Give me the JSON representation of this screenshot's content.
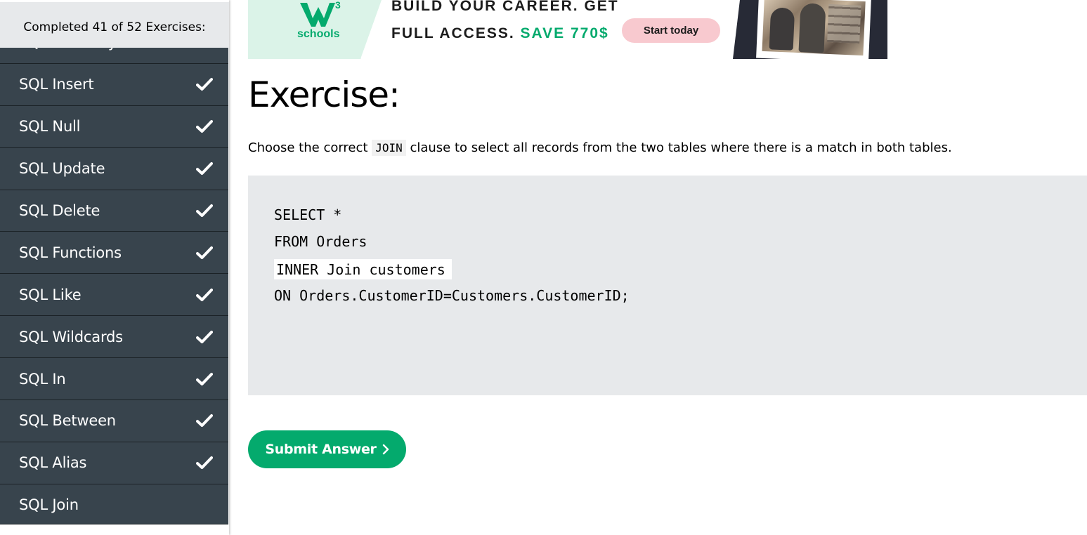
{
  "sidebar": {
    "progress_text": "Completed 41 of 52 Exercises:",
    "partial_item_label": "SQL Order By",
    "items": [
      {
        "label": "SQL Insert",
        "completed": true
      },
      {
        "label": "SQL Null",
        "completed": true
      },
      {
        "label": "SQL Update",
        "completed": true
      },
      {
        "label": "SQL Delete",
        "completed": true
      },
      {
        "label": "SQL Functions",
        "completed": true
      },
      {
        "label": "SQL Like",
        "completed": true
      },
      {
        "label": "SQL Wildcards",
        "completed": true
      },
      {
        "label": "SQL In",
        "completed": true
      },
      {
        "label": "SQL Between",
        "completed": true
      },
      {
        "label": "SQL Alias",
        "completed": true
      },
      {
        "label": "SQL Join",
        "completed": false
      }
    ]
  },
  "ad": {
    "logo_text": "schools",
    "line1": "BUILD YOUR CAREER. GET",
    "line2_prefix": "FULL ACCESS.",
    "line2_accent": "SAVE 770$",
    "cta_label": "Start today"
  },
  "main": {
    "title": "Exercise:",
    "instruction_before": "Choose the correct",
    "instruction_code": "JOIN",
    "instruction_after": "clause to select all records from the two tables where there is a match in both tables.",
    "code": {
      "line1": "SELECT *",
      "line2": "FROM Orders",
      "input_value": "INNER Join customers",
      "line4": "ON Orders.CustomerID=Customers.CustomerID;"
    },
    "submit_label": "Submit Answer"
  },
  "colors": {
    "sidebar_bg": "#38444d",
    "accent_green": "#04aa6d",
    "code_bg": "#e7e9eb",
    "cta_pink": "#f8c9cf"
  },
  "icons": {
    "completed": "checkmark-icon",
    "submit": "chevron-right-icon",
    "logo": "w3schools-logo"
  }
}
